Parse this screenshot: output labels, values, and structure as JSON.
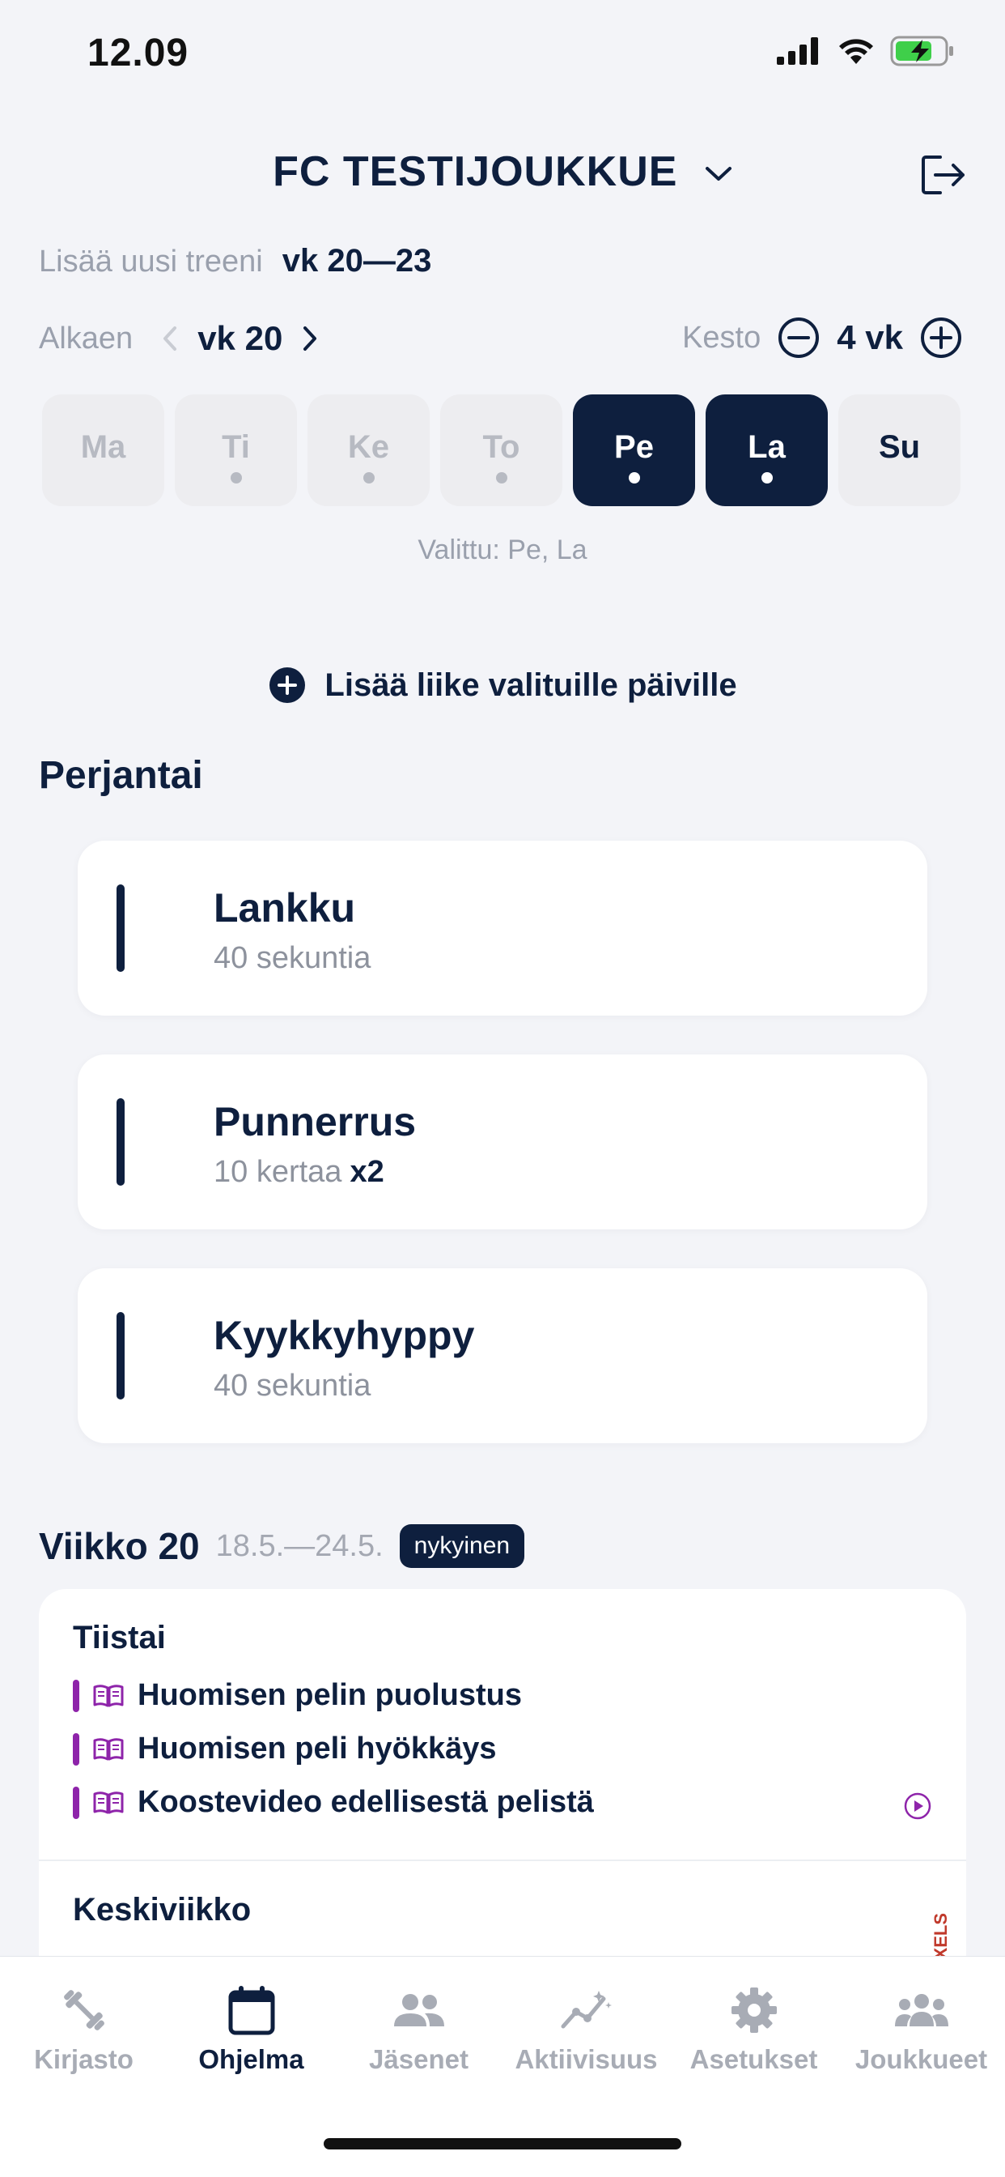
{
  "status": {
    "time": "12.09"
  },
  "header": {
    "team_name": "FC TESTIJOUKKUE"
  },
  "add_training": {
    "label": "Lisää uusi treeni",
    "weeks": "vk 20—23"
  },
  "start": {
    "label": "Alkaen",
    "week": "vk 20"
  },
  "duration": {
    "label": "Kesto",
    "value": "4 vk"
  },
  "days": [
    {
      "label": "Ma",
      "dot": false,
      "selected": false
    },
    {
      "label": "Ti",
      "dot": true,
      "selected": false
    },
    {
      "label": "Ke",
      "dot": true,
      "selected": false
    },
    {
      "label": "To",
      "dot": true,
      "selected": false
    },
    {
      "label": "Pe",
      "dot": true,
      "selected": true
    },
    {
      "label": "La",
      "dot": true,
      "selected": true
    },
    {
      "label": "Su",
      "dot": false,
      "selected": false
    }
  ],
  "selected_text": "Valittu: Pe, La",
  "add_move_label": "Lisää liike valituille päiville",
  "section_title": "Perjantai",
  "exercises": [
    {
      "name": "Lankku",
      "detail": "40 sekuntia",
      "multiplier": ""
    },
    {
      "name": "Punnerrus",
      "detail": "10 kertaa",
      "multiplier": "x2"
    },
    {
      "name": "Kyykkyhyppy",
      "detail": "40 sekuntia",
      "multiplier": ""
    }
  ],
  "week": {
    "title": "Viikko 20",
    "range": "18.5.—24.5.",
    "badge": "nykyinen",
    "days": [
      {
        "name": "Tiistai",
        "items": [
          "Huomisen pelin puolustus",
          "Huomisen peli hyökkäys",
          "Koostevideo edellisestä pelistä"
        ]
      },
      {
        "name": "Keskiviikko",
        "items": []
      }
    ],
    "watermark": "PEXELS"
  },
  "tabs": [
    {
      "label": "Kirjasto",
      "icon": "dumbbell-icon",
      "active": false
    },
    {
      "label": "Ohjelma",
      "icon": "calendar-icon",
      "active": true
    },
    {
      "label": "Jäsenet",
      "icon": "members-icon",
      "active": false
    },
    {
      "label": "Aktiivisuus",
      "icon": "activity-icon",
      "active": false
    },
    {
      "label": "Asetukset",
      "icon": "gear-icon",
      "active": false
    },
    {
      "label": "Joukkueet",
      "icon": "teams-icon",
      "active": false
    }
  ],
  "colors": {
    "primary": "#0e1f3e",
    "muted": "#9aa0ad",
    "background": "#f3f4f8",
    "video_accent": "#8e24aa"
  }
}
